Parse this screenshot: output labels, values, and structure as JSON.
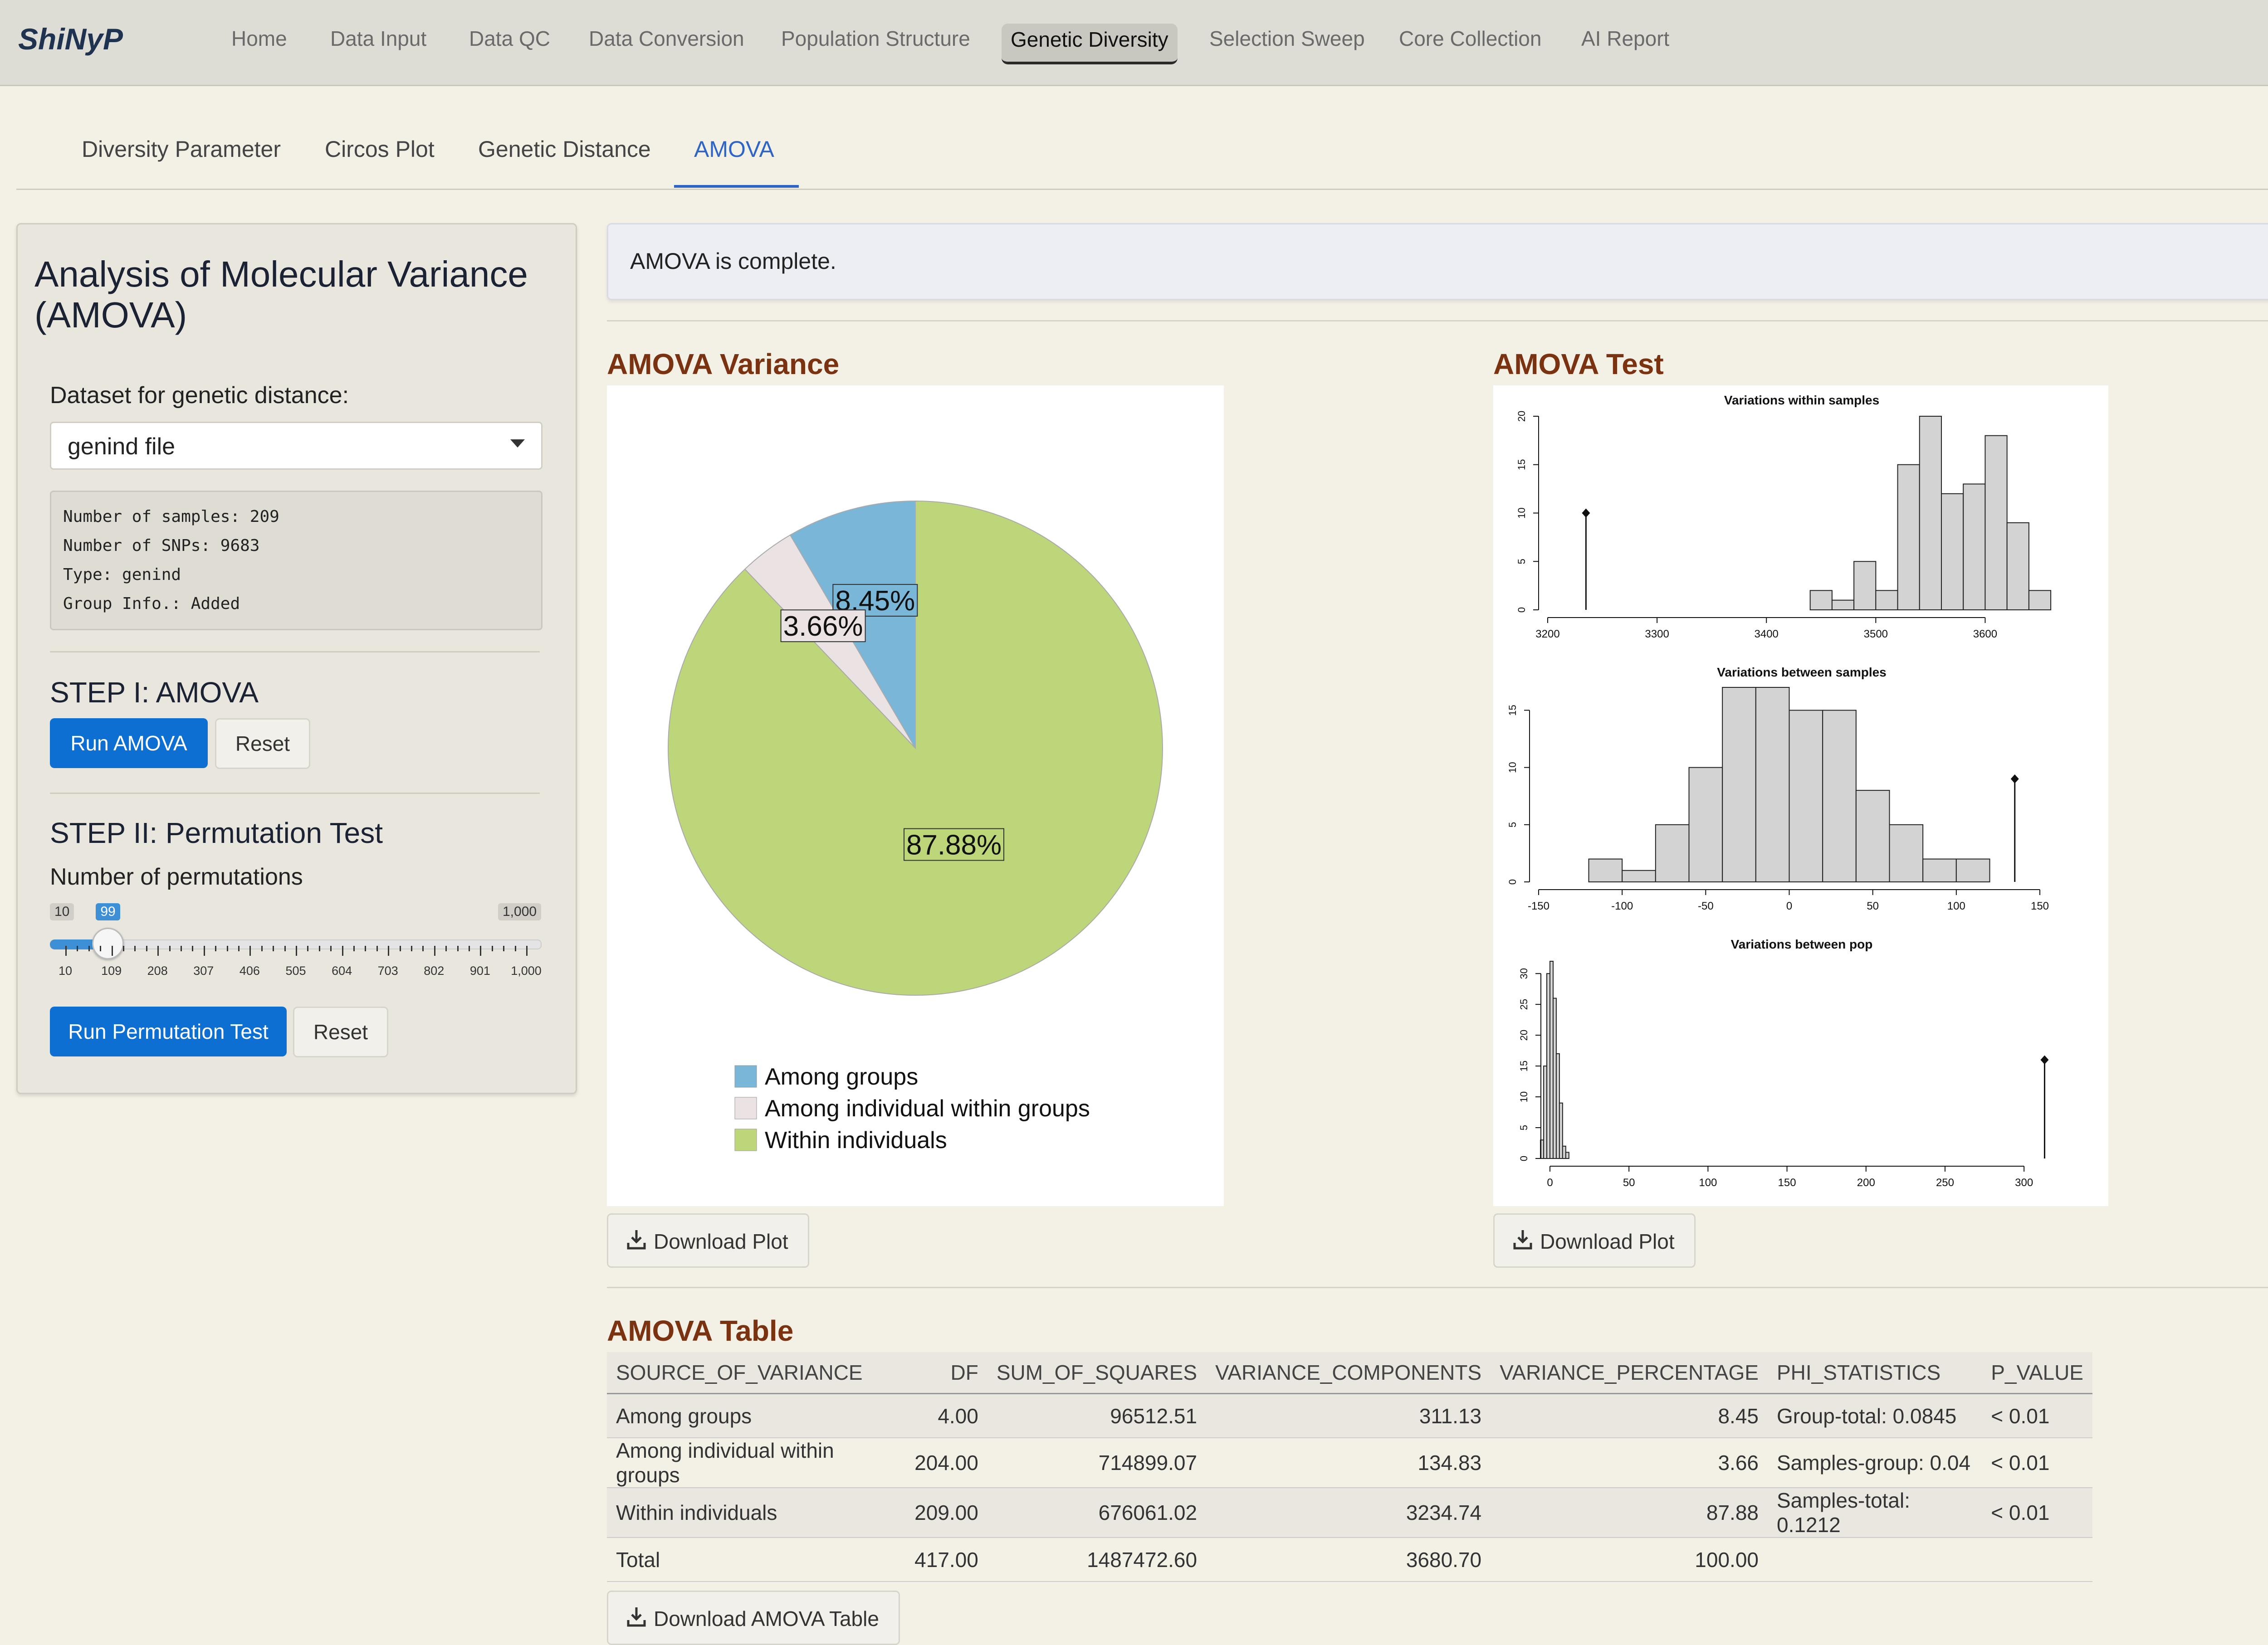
{
  "app": {
    "brand": "ShiNyP",
    "nav": [
      "Home",
      "Data Input",
      "Data QC",
      "Data Conversion",
      "Population Structure",
      "Genetic Diversity",
      "Selection Sweep",
      "Core Collection",
      "AI Report"
    ],
    "active_nav": "Genetic Diversity"
  },
  "subtabs": {
    "items": [
      "Diversity Parameter",
      "Circos Plot",
      "Genetic Distance",
      "AMOVA"
    ],
    "active": "AMOVA"
  },
  "sidebar": {
    "title": "Analysis of Molecular Variance (AMOVA)",
    "dataset_label": "Dataset for genetic distance:",
    "dataset_value": "genind file",
    "info": {
      "line1": "Number of samples: 209",
      "line2": "Number of SNPs: 9683",
      "line3": "Type: genind",
      "line4": "Group Info.: Added"
    },
    "step1_title": "STEP I: AMOVA",
    "run_amova_label": "Run AMOVA",
    "reset_label": "Reset",
    "step2_title": "STEP II: Permutation Test",
    "perm_label": "Number of permutations",
    "slider": {
      "min": 10,
      "max": 1000,
      "value": 99,
      "min_label": "10",
      "max_label": "1,000",
      "value_label": "99",
      "ticks": [
        "10",
        "109",
        "208",
        "307",
        "406",
        "505",
        "604",
        "703",
        "802",
        "901",
        "1,000"
      ]
    },
    "run_perm_label": "Run Permutation Test",
    "reset2_label": "Reset"
  },
  "alert": {
    "text": "AMOVA is complete."
  },
  "variance_section": {
    "title": "AMOVA Variance",
    "download_label": "Download Plot"
  },
  "test_section": {
    "title": "AMOVA Test",
    "download_label": "Download Plot"
  },
  "table_section": {
    "title": "AMOVA Table",
    "download_label": "Download AMOVA Table",
    "headers": [
      "SOURCE_OF_VARIANCE",
      "DF",
      "SUM_OF_SQUARES",
      "VARIANCE_COMPONENTS",
      "VARIANCE_PERCENTAGE",
      "PHI_STATISTICS",
      "P_VALUE"
    ],
    "rows": [
      [
        "Among groups",
        "4.00",
        "96512.51",
        "311.13",
        "8.45",
        "Group-total: 0.0845",
        "< 0.01"
      ],
      [
        "Among individual within groups",
        "204.00",
        "714899.07",
        "134.83",
        "3.66",
        "Samples-group: 0.04",
        "< 0.01"
      ],
      [
        "Within individuals",
        "209.00",
        "676061.02",
        "3234.74",
        "87.88",
        "Samples-total: 0.1212",
        "< 0.01"
      ],
      [
        "Total",
        "417.00",
        "1487472.60",
        "3680.70",
        "100.00",
        "",
        ""
      ]
    ]
  },
  "colors": {
    "among_groups": "#7ab6d8",
    "among_individual": "#ebe3e3",
    "within": "#bdd67a",
    "accent": "#0d6fd1",
    "section_title": "#7b3211"
  },
  "chart_data": [
    {
      "type": "pie",
      "slices": [
        {
          "label": "Among groups",
          "value": 8.45,
          "text": "8.45%"
        },
        {
          "label": "Among individual within groups",
          "value": 3.66,
          "text": "3.66%"
        },
        {
          "label": "Within individuals",
          "value": 87.88,
          "text": "87.88%"
        }
      ],
      "legend": [
        "Among groups",
        "Among individual within groups",
        "Within individuals"
      ],
      "legend_position": "bottom"
    },
    {
      "type": "bar",
      "title": "Variations within samples",
      "xlim": [
        3200,
        3650
      ],
      "ylim": [
        0,
        20
      ],
      "x_ticks": [
        "3200",
        "3300",
        "3400",
        "3500",
        "3600"
      ],
      "y_ticks": [
        "0",
        "5",
        "10",
        "15",
        "20"
      ],
      "bins": [
        [
          3440,
          3460,
          2
        ],
        [
          3460,
          3480,
          1
        ],
        [
          3480,
          3500,
          5
        ],
        [
          3500,
          3520,
          2
        ],
        [
          3520,
          3540,
          15
        ],
        [
          3540,
          3560,
          20
        ],
        [
          3560,
          3580,
          12
        ],
        [
          3580,
          3600,
          13
        ],
        [
          3600,
          3620,
          18
        ],
        [
          3620,
          3640,
          9
        ],
        [
          3640,
          3660,
          2
        ]
      ],
      "observed": 3235,
      "observed_height": 10
    },
    {
      "type": "bar",
      "title": "Variations between samples",
      "xlim": [
        -150,
        150
      ],
      "ylim": [
        0,
        17
      ],
      "x_ticks": [
        "-150",
        "-100",
        "-50",
        "0",
        "50",
        "100",
        "150"
      ],
      "y_ticks": [
        "0",
        "5",
        "10",
        "15"
      ],
      "bins": [
        [
          -120,
          -100,
          2
        ],
        [
          -100,
          -80,
          1
        ],
        [
          -80,
          -60,
          5
        ],
        [
          -60,
          -40,
          10
        ],
        [
          -40,
          -20,
          17
        ],
        [
          -20,
          0,
          17
        ],
        [
          0,
          20,
          15
        ],
        [
          20,
          40,
          15
        ],
        [
          40,
          60,
          8
        ],
        [
          60,
          80,
          5
        ],
        [
          80,
          100,
          2
        ],
        [
          100,
          120,
          2
        ]
      ],
      "observed": 135,
      "observed_height": 9
    },
    {
      "type": "bar",
      "title": "Variations between pop",
      "xlim": [
        0,
        310
      ],
      "ylim": [
        0,
        32
      ],
      "x_ticks": [
        "0",
        "50",
        "100",
        "150",
        "200",
        "250",
        "300"
      ],
      "y_ticks": [
        "0",
        "5",
        "10",
        "15",
        "20",
        "25",
        "30"
      ],
      "bins": [
        [
          -6,
          -4,
          3
        ],
        [
          -4,
          -2,
          15
        ],
        [
          -2,
          0,
          30
        ],
        [
          0,
          2,
          32
        ],
        [
          2,
          4,
          26
        ],
        [
          4,
          6,
          17
        ],
        [
          6,
          8,
          9
        ],
        [
          8,
          10,
          2
        ],
        [
          10,
          12,
          1
        ]
      ],
      "observed": 313,
      "observed_height": 16
    }
  ]
}
